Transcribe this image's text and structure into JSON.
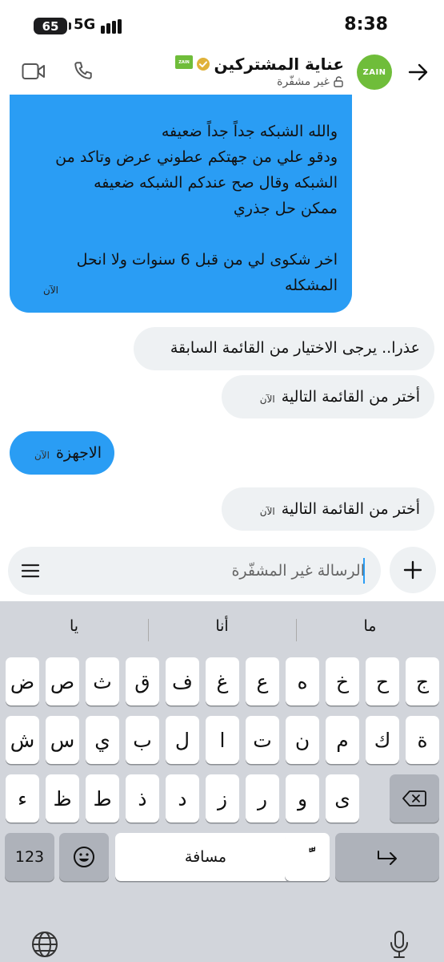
{
  "status_bar": {
    "battery": "65",
    "network": "5G",
    "time": "8:38"
  },
  "header": {
    "contact_name": "عناية المشتركين",
    "encryption_status": "غير مشفّرة",
    "avatar_text": "ZAIN",
    "brand_logo_text": "ZAIN"
  },
  "messages": {
    "m1": {
      "lines": [
        "والله الشبكه جداً جداً ضعيفه",
        "ودقو علي من جهتكم عطوني عرض وتاكد من",
        "الشبكه وقال صح عندكم الشبكه ضعيفه",
        "ممكن حل جذري",
        "اخر شكوى لي من قبل 6 سنوات ولا انحل",
        "المشكله"
      ],
      "time": "الآن"
    },
    "m2": {
      "text": "عذرا.. يرجى الاختيار من القائمة السابقة"
    },
    "m3": {
      "text": "أختر من القائمة التالية",
      "time": "الآن"
    },
    "m4": {
      "text": "الاجهزة",
      "time": "الآن"
    },
    "m5": {
      "text": "أختر من القائمة التالية",
      "time": "الآن"
    }
  },
  "composer": {
    "placeholder": "الرسالة غير المشفّرة"
  },
  "keyboard": {
    "suggestions": [
      "ما",
      "أنا",
      "يا"
    ],
    "row1": [
      "ج",
      "ح",
      "خ",
      "ه",
      "ع",
      "غ",
      "ف",
      "ق",
      "ث",
      "ص",
      "ض"
    ],
    "row2": [
      "ة",
      "ك",
      "م",
      "ن",
      "ت",
      "ا",
      "ل",
      "ب",
      "ي",
      "س",
      "ش"
    ],
    "row3": [
      "ى",
      "و",
      "ر",
      "ز",
      "د",
      "ذ",
      "ط",
      "ظ",
      "ء"
    ],
    "numbers_key": "123",
    "space_key": "مسافة",
    "diacritic_key": "ًّ"
  },
  "colors": {
    "sent_bubble": "#2a9df4",
    "received_bubble": "#eef1f3",
    "keyboard_bg": "#d2d5db",
    "brand": "#6fbd3a"
  }
}
